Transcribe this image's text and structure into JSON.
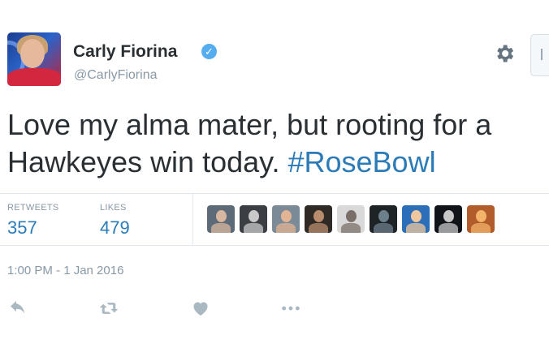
{
  "user": {
    "name": "Carly Fiorina",
    "handle": "@CarlyFiorina",
    "verified": true
  },
  "tweet": {
    "text_line1": "Love my alma mater, but rooting for a",
    "text_line2_plain": "Hawkeyes win today. ",
    "hashtag": "#RoseBowl"
  },
  "stats": {
    "retweets_label": "RETWEETS",
    "retweets_value": "357",
    "likes_label": "LIKES",
    "likes_value": "479"
  },
  "likers": [
    {
      "icon": "liker-avatar-1",
      "bg": "#5d6b78",
      "fg": "#d8b7a0"
    },
    {
      "icon": "liker-avatar-2",
      "bg": "#3b3f44",
      "fg": "#c9c9c9"
    },
    {
      "icon": "liker-avatar-3",
      "bg": "#7a8a97",
      "fg": "#e3b493"
    },
    {
      "icon": "liker-avatar-4",
      "bg": "#2f2a26",
      "fg": "#b88d6e"
    },
    {
      "icon": "liker-avatar-5",
      "bg": "#d9d9d9",
      "fg": "#7a6f68"
    },
    {
      "icon": "liker-avatar-6",
      "bg": "#1e2326",
      "fg": "#6e7f8c"
    },
    {
      "icon": "liker-avatar-7",
      "bg": "#2c6fb8",
      "fg": "#f0c79e"
    },
    {
      "icon": "liker-avatar-8",
      "bg": "#111418",
      "fg": "#c7c7c7"
    },
    {
      "icon": "liker-avatar-9",
      "bg": "#b35c2b",
      "fg": "#f2b36b"
    }
  ],
  "timestamp": "1:00 PM - 1 Jan 2016",
  "actions": [
    "reply-icon",
    "retweet-icon",
    "like-icon",
    "more-icon"
  ],
  "colors": {
    "link": "#2b7bb9",
    "muted": "#8899a6",
    "verified": "#55acee",
    "text": "#292f33"
  }
}
